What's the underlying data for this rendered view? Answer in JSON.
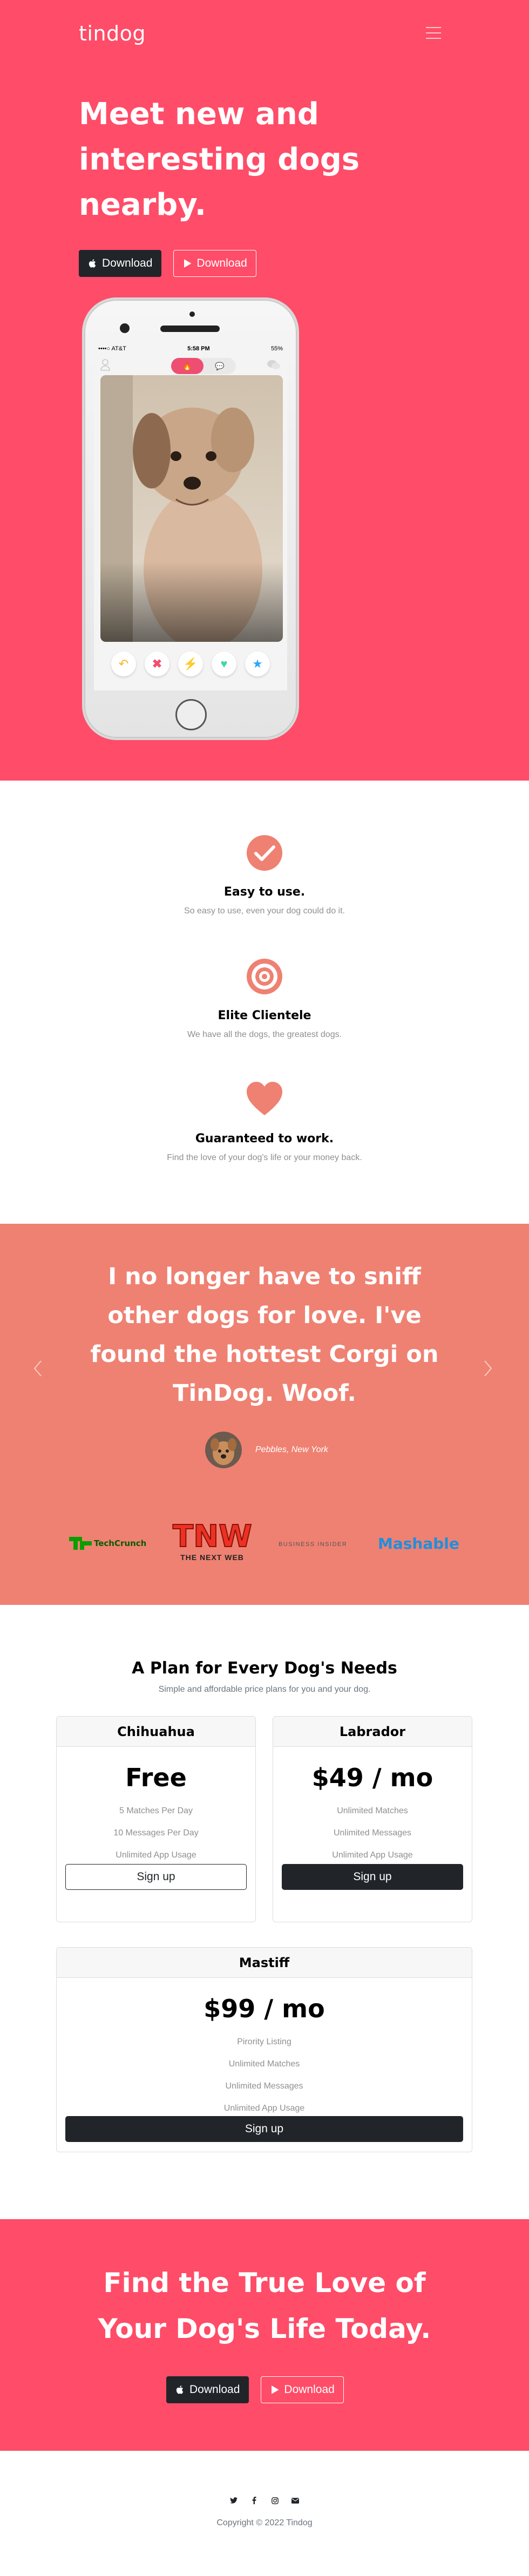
{
  "header": {
    "brand": "tindog",
    "menu_icon": "hamburger-icon"
  },
  "hero": {
    "title": "Meet new and interesting dogs nearby.",
    "apple_download_label": "Download",
    "play_download_label": "Download",
    "phone": {
      "carrier": "••••○ AT&T",
      "time": "5:58 PM",
      "battery": "55%",
      "actions": [
        "undo-icon",
        "nope-icon",
        "boost-icon",
        "like-icon",
        "super-like-icon"
      ]
    }
  },
  "features": [
    {
      "title": "Easy to use.",
      "text": "So easy to use, even your dog could do it.",
      "icon": "check-circle-icon"
    },
    {
      "title": "Elite Clientele",
      "text": "We have all the dogs, the greatest dogs.",
      "icon": "bullseye-icon"
    },
    {
      "title": "Guaranteed to work.",
      "text": "Find the love of your dog's life or your money back.",
      "icon": "heart-icon"
    }
  ],
  "testimonial": {
    "quote": "I no longer have to sniff other dogs for love. I've found the hottest Corgi on TinDog. Woof.",
    "author": "Pebbles, New York"
  },
  "press": {
    "techcrunch": "TechCrunch",
    "tnw_logo": "TNW",
    "tnw_name": "THE NEXT WEB",
    "business_insider": "BUSINESS INSIDER",
    "mashable": "Mashable"
  },
  "pricing": {
    "title": "A Plan for Every Dog's Needs",
    "subtitle": "Simple and affordable price plans for you and your dog.",
    "plans": [
      {
        "name": "Chihuahua",
        "price": "Free",
        "features": [
          "5 Matches Per Day",
          "10 Messages Per Day",
          "Unlimited App Usage"
        ],
        "button": "Sign up"
      },
      {
        "name": "Labrador",
        "price": "$49 / mo",
        "features": [
          "Unlimited Matches",
          "Unlimited Messages",
          "Unlimited App Usage"
        ],
        "button": "Sign up"
      },
      {
        "name": "Mastiff",
        "price": "$99 / mo",
        "features": [
          "Pirority Listing",
          "Unlimited Matches",
          "Unlimited Messages",
          "Unlimited App Usage"
        ],
        "button": "Sign up"
      }
    ]
  },
  "cta": {
    "title": "Find the True Love of Your Dog's Life Today.",
    "apple_download_label": "Download",
    "play_download_label": "Download"
  },
  "footer": {
    "social": [
      "twitter-icon",
      "facebook-icon",
      "instagram-icon",
      "email-icon"
    ],
    "copyright": "Copyright © 2022 Tindog"
  },
  "colors": {
    "hero_bg": "#ff4c68",
    "testimonial_bg": "#ef8172",
    "feature_icon": "#ef8172",
    "dark_button": "#212529"
  }
}
